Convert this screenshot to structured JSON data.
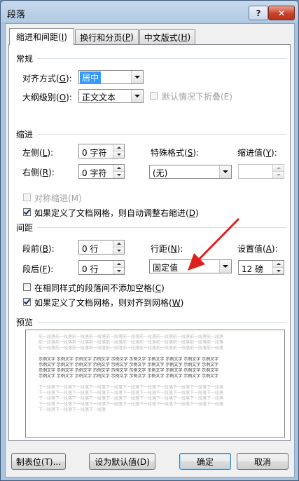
{
  "window": {
    "title": "段落",
    "help_label": "?",
    "close_label": "✕"
  },
  "tabs": [
    {
      "label": "缩进和间距(",
      "key": "I",
      "suffix": ")",
      "active": true
    },
    {
      "label": "换行和分页(",
      "key": "P",
      "suffix": ")",
      "active": false
    },
    {
      "label": "中文版式(",
      "key": "H",
      "suffix": ")",
      "active": false
    }
  ],
  "general": {
    "heading": "常规",
    "alignment_label_pre": "对齐方式(",
    "alignment_key": "G",
    "alignment_label_post": "):",
    "alignment_value": "居中",
    "outline_label_pre": "大纲级别(",
    "outline_key": "O",
    "outline_label_post": "):",
    "outline_value": "正文文本",
    "collapse_label": "默认情况下折叠(E)"
  },
  "indent": {
    "heading": "缩进",
    "left_label_pre": "左侧(",
    "left_key": "L",
    "left_label_post": "):",
    "left_value": "0 字符",
    "right_label_pre": "右侧(",
    "right_key": "R",
    "right_label_post": "):",
    "right_value": "0 字符",
    "special_label_pre": "特殊格式(",
    "special_key": "S",
    "special_label_post": "):",
    "special_value": "(无)",
    "by_label_pre": "缩进值(",
    "by_key": "Y",
    "by_label_post": "):",
    "by_value": "",
    "mirror_label": "对称缩进(M)",
    "auto_adjust_label_pre": "如果定义了文档网格，则自动调整右缩进(",
    "auto_adjust_key": "D",
    "auto_adjust_label_post": ")"
  },
  "spacing": {
    "heading": "间距",
    "before_label_pre": "段前(",
    "before_key": "B",
    "before_label_post": "):",
    "before_value": "0 行",
    "after_label_pre": "段后(",
    "after_key": "F",
    "after_label_post": "):",
    "after_value": "0 行",
    "line_label_pre": "行距(",
    "line_key": "N",
    "line_label_post": "):",
    "line_value": "固定值",
    "at_label_pre": "设置值(",
    "at_key": "A",
    "at_label_post": "):",
    "at_value": "12 磅",
    "no_space_label_pre": "在相同样式的段落间不添加空格(",
    "no_space_key": "C",
    "no_space_label_post": ")",
    "snap_label_pre": "如果定义了文档网格，则对齐到网格(",
    "snap_key": "W",
    "snap_label_post": ")"
  },
  "preview": {
    "heading": "预览",
    "prev_text": "前一段落前一段落前一段落前一段落前一段落前一段落前一段落前一段落前一段落前一段落前一段落",
    "sample_text": "示例文字 示例文字 示例文字 示例文字 示例文字 示例文字 示例文字 示例文字 示例文字 示例文字",
    "next_text": "下一段落下一段落下一段落下一段落下一段落下一段落下一段落下一段落下一段落下一段落下一段落",
    "last_text": "下一段落下一段落下一段落下一段落"
  },
  "buttons": {
    "tabs_label": "制表位(T)...",
    "default_label": "设为默认值(D)",
    "ok_label": "确定",
    "cancel_label": "取消"
  },
  "colors": {
    "selection": "#3399ff",
    "annotation_arrow": "#e0201c"
  }
}
